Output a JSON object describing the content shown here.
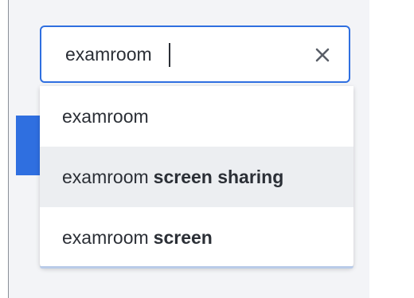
{
  "search": {
    "query": "examroom"
  },
  "suggestions": [
    {
      "base": "examroom",
      "completion": ""
    },
    {
      "base": "examroom",
      "completion": "screen sharing"
    },
    {
      "base": "examroom",
      "completion": "screen"
    }
  ],
  "colors": {
    "accent": "#2f6fe0",
    "highlighted_row": "#eceef1",
    "panel": "#f3f4f7"
  },
  "icons": {
    "clear": "close-icon"
  }
}
